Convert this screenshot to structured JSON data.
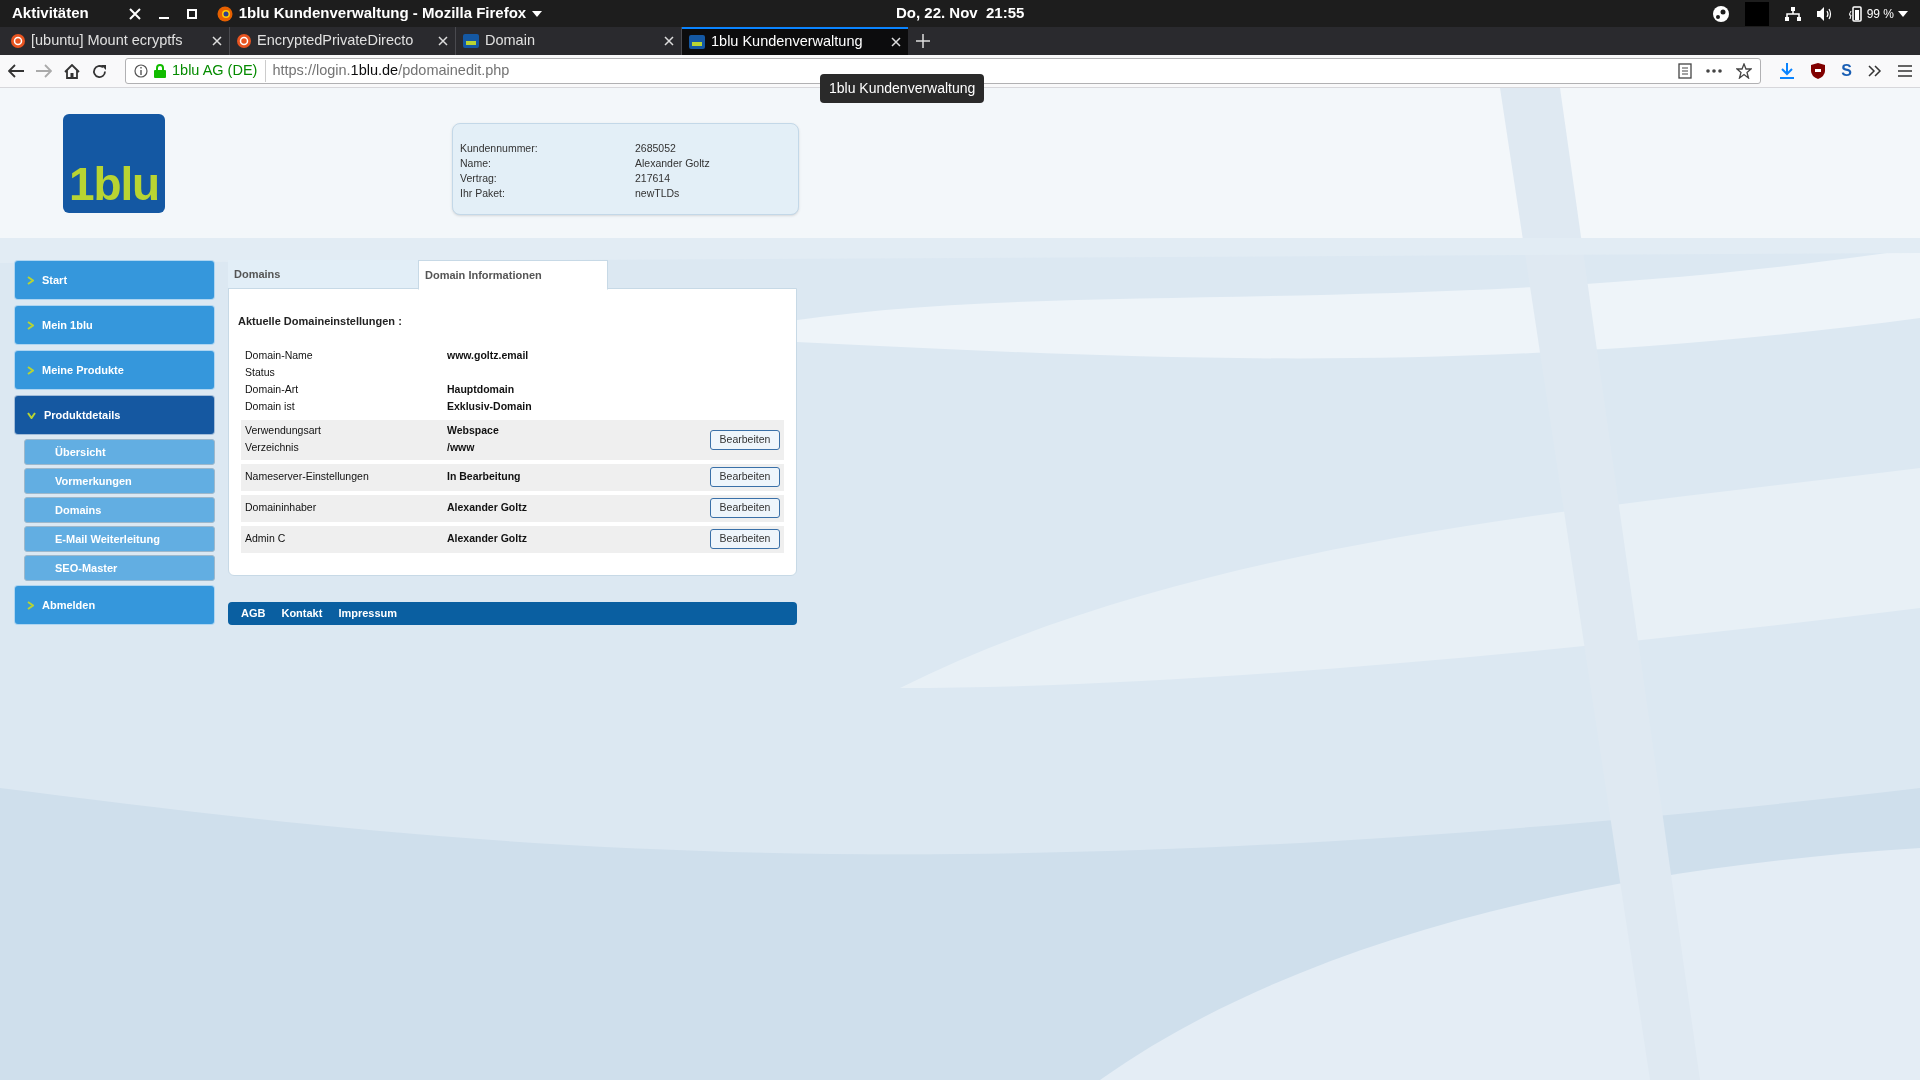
{
  "system_bar": {
    "activities": "Aktivitäten",
    "app_title": "1blu Kundenverwaltung - Mozilla Firefox",
    "clock": "Do, 22. Nov  21:55",
    "battery": "99 %"
  },
  "browser_tabs": [
    {
      "title": "[ubuntu] Mount ecryptfs",
      "kind": "ubuntu",
      "selected": false
    },
    {
      "title": "EncryptedPrivateDirecto",
      "kind": "ubuntu",
      "selected": false
    },
    {
      "title": "Domain",
      "kind": "site",
      "selected": false
    },
    {
      "title": "1blu Kundenverwaltung",
      "kind": "site",
      "selected": true
    }
  ],
  "address_bar": {
    "identity": "1blu AG (DE)",
    "url_prefix": "https://login.",
    "url_domain": "1blu.de",
    "url_path": "/pdomainedit.php",
    "extension_letter": "S"
  },
  "tooltip": "1blu Kundenverwaltung",
  "logo": "1blu",
  "customer_info": [
    {
      "label": "Kundennummer:",
      "value": "2685052"
    },
    {
      "label": "Name:",
      "value": "Alexander Goltz"
    },
    {
      "label": "Vertrag:",
      "value": "217614"
    },
    {
      "label": "Ihr Paket:",
      "value": "newTLDs"
    }
  ],
  "nav": [
    {
      "label": "Start",
      "expanded": false
    },
    {
      "label": "Mein 1blu",
      "expanded": false
    },
    {
      "label": "Meine Produkte",
      "expanded": false
    },
    {
      "label": "Produktdetails",
      "expanded": true,
      "children": [
        {
          "label": "Übersicht"
        },
        {
          "label": "Vormerkungen"
        },
        {
          "label": "Domains"
        },
        {
          "label": "E-Mail Weiterleitung"
        },
        {
          "label": "SEO-Master"
        }
      ]
    },
    {
      "label": "Abmelden",
      "expanded": false
    }
  ],
  "content_tabs": [
    {
      "label": "Domains",
      "selected": false
    },
    {
      "label": "Domain Informationen",
      "selected": true
    }
  ],
  "section_title": "Aktuelle Domaineinstellungen :",
  "settings": [
    {
      "kind": "plain",
      "rows": [
        {
          "label": "Domain-Name",
          "value": "www.goltz.email"
        },
        {
          "label": "Status"
        },
        {
          "label": "Domain-Art",
          "value": "Hauptdomain"
        },
        {
          "label": "Domain ist",
          "value": "Exklusiv-Domain"
        }
      ]
    },
    {
      "kind": "editable",
      "button": "Bearbeiten",
      "rows": [
        {
          "label": "Verwendungsart",
          "value": "Webspace"
        },
        {
          "label": "Verzeichnis",
          "value": "/www"
        }
      ]
    },
    {
      "kind": "editable",
      "button": "Bearbeiten",
      "rows": [
        {
          "label": "Nameserver-Einstellungen",
          "value": "In Bearbeitung"
        }
      ]
    },
    {
      "kind": "editable",
      "button": "Bearbeiten",
      "rows": [
        {
          "label": "Domaininhaber",
          "value": "Alexander Goltz"
        }
      ]
    },
    {
      "kind": "editable",
      "button": "Bearbeiten",
      "rows": [
        {
          "label": "Admin C",
          "value": "Alexander Goltz"
        }
      ]
    }
  ],
  "footer_links": [
    "AGB",
    "Kontakt",
    "Impressum"
  ]
}
